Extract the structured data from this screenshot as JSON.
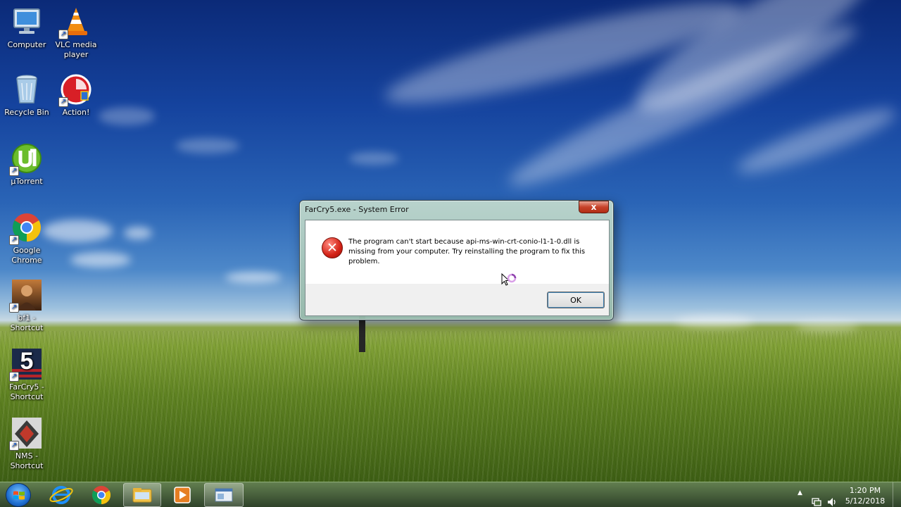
{
  "desktop": {
    "icons": [
      {
        "label": "Computer"
      },
      {
        "label": "VLC media player"
      },
      {
        "label": "Recycle Bin"
      },
      {
        "label": "Action!"
      },
      {
        "label": "µTorrent"
      },
      {
        "label": "Google Chrome"
      },
      {
        "label": "bf1 - Shortcut"
      },
      {
        "label": "FarCry5 - Shortcut"
      },
      {
        "label": "NMS - Shortcut"
      }
    ]
  },
  "dialog": {
    "title": "FarCry5.exe - System Error",
    "close_label": "x",
    "message": "The program can't start because api-ms-win-crt-conio-l1-1-0.dll is missing from your computer. Try reinstalling the program to fix this problem.",
    "ok_label": "OK",
    "error_glyph": "✕"
  },
  "taskbar": {
    "items": [
      "start-orb",
      "internet-explorer-icon",
      "chrome-icon",
      "file-explorer-icon",
      "media-player-icon",
      "system-error-window"
    ],
    "clock": {
      "time": "1:20 PM",
      "date": "5/12/2018"
    },
    "tray_overflow": "▲"
  },
  "colors": {
    "close_red": "#c7432a",
    "error_red": "#d32216",
    "taskbar": "#3f5a34"
  }
}
